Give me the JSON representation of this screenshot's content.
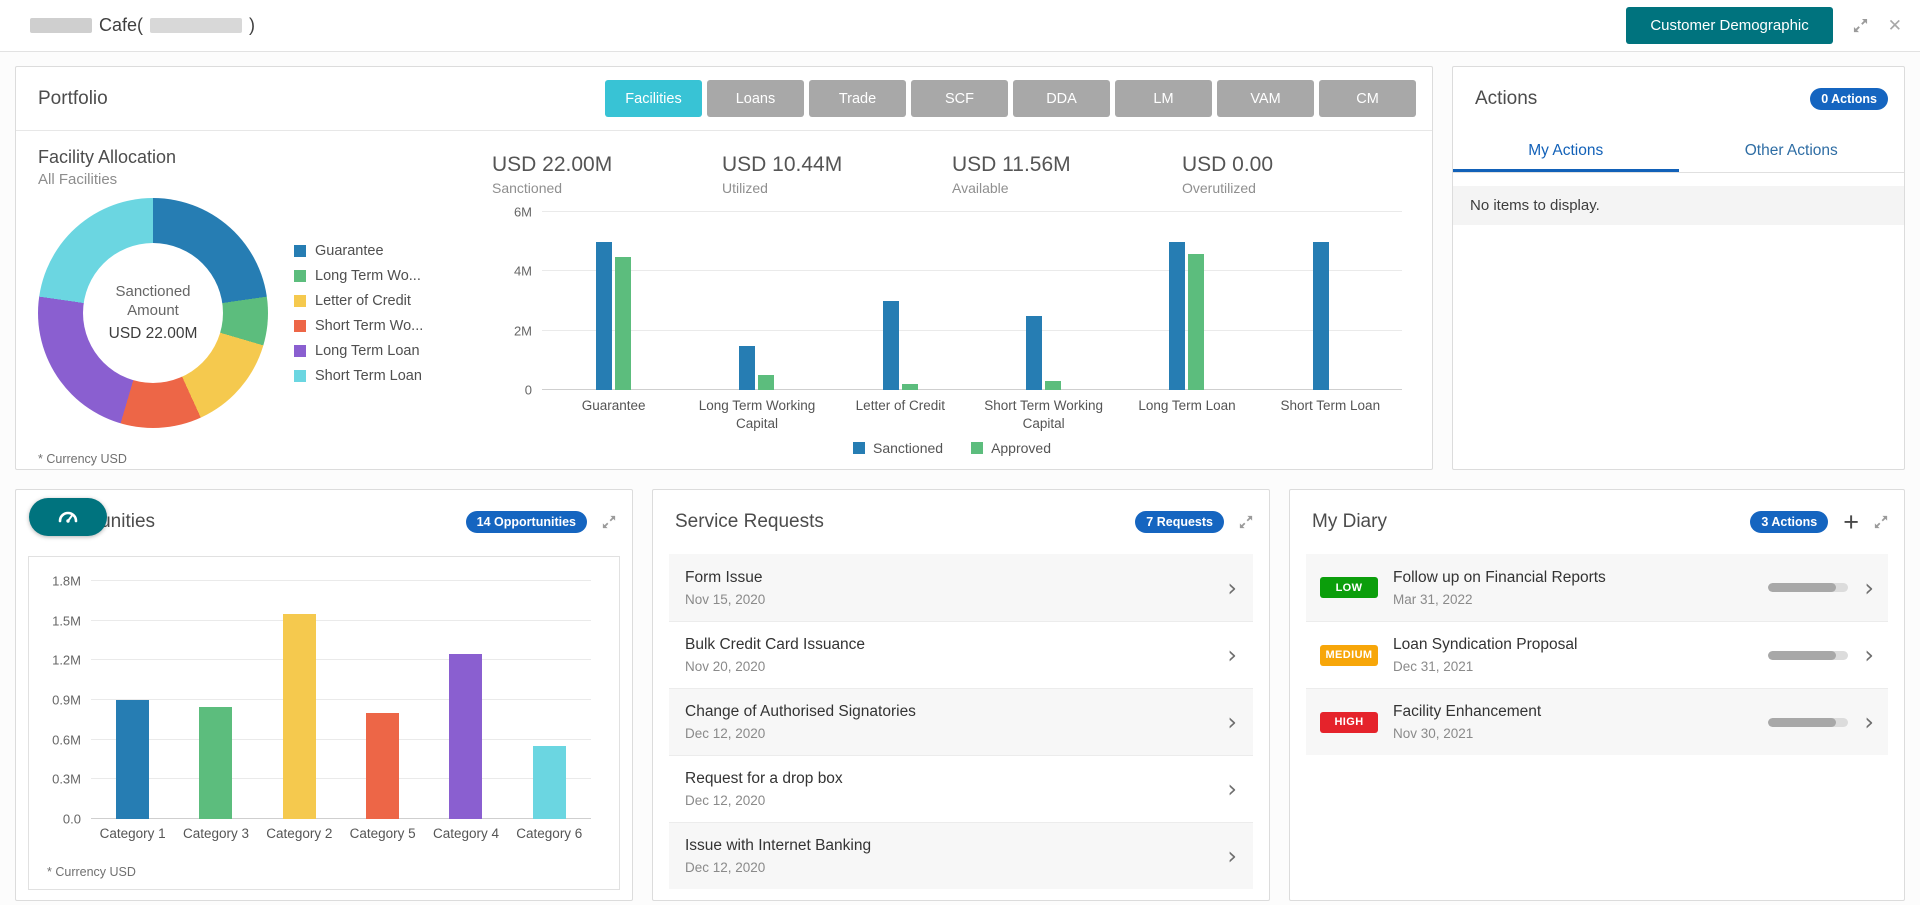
{
  "colors": {
    "accent_teal": "#00737e",
    "active_tab_cyan": "#38c3d5",
    "inactive_tab_gray": "#a8a8a8",
    "badge_blue": "#1565c0"
  },
  "icons": {
    "chevron_right": "›",
    "close": "✕",
    "plus": "+"
  },
  "header": {
    "title_cafe": "Cafe(",
    "title_paren": ")",
    "demographic_button": "Customer Demographic"
  },
  "portfolio": {
    "title": "Portfolio",
    "tabs": [
      {
        "label": "Facilities",
        "active": true
      },
      {
        "label": "Loans",
        "active": false
      },
      {
        "label": "Trade",
        "active": false
      },
      {
        "label": "SCF",
        "active": false
      },
      {
        "label": "DDA",
        "active": false
      },
      {
        "label": "LM",
        "active": false
      },
      {
        "label": "VAM",
        "active": false
      },
      {
        "label": "CM",
        "active": false
      }
    ],
    "facility_allocation": {
      "title": "Facility Allocation",
      "subtitle": "All Facilities",
      "center_label": "Sanctioned Amount",
      "center_value": "USD 22.00M",
      "footnote": "* Currency USD"
    },
    "summary": [
      {
        "value": "USD 22.00M",
        "label": "Sanctioned"
      },
      {
        "value": "USD 10.44M",
        "label": "Utilized"
      },
      {
        "value": "USD 11.56M",
        "label": "Available"
      },
      {
        "value": "USD 0.00",
        "label": "Overutilized"
      }
    ]
  },
  "actions": {
    "title": "Actions",
    "badge": "0 Actions",
    "tabs": [
      "My Actions",
      "Other Actions"
    ],
    "empty_message": "No items to display."
  },
  "opportunities": {
    "title": "Opportunities",
    "badge": "14 Opportunities",
    "footnote": "* Currency USD"
  },
  "service_requests": {
    "title": "Service Requests",
    "badge": "7 Requests",
    "items": [
      {
        "title": "Form Issue",
        "date": "Nov 15, 2020"
      },
      {
        "title": "Bulk Credit Card Issuance",
        "date": "Nov 20, 2020"
      },
      {
        "title": "Change of Authorised Signatories",
        "date": "Dec 12, 2020"
      },
      {
        "title": "Request for a drop box",
        "date": "Dec 12, 2020"
      },
      {
        "title": "Issue with Internet Banking",
        "date": "Dec 12, 2020"
      }
    ]
  },
  "my_diary": {
    "title": "My Diary",
    "badge": "3 Actions",
    "items": [
      {
        "priority": "LOW",
        "priority_color": "#0b9e0b",
        "title": "Follow up on Financial Reports",
        "date": "Mar 31, 2022",
        "progress_percent": 85
      },
      {
        "priority": "MEDIUM",
        "priority_color": "#f7a609",
        "title": "Loan Syndication Proposal",
        "date": "Dec 31, 2021",
        "progress_percent": 85
      },
      {
        "priority": "HIGH",
        "priority_color": "#e5232b",
        "title": "Facility Enhancement",
        "date": "Nov 30, 2021",
        "progress_percent": 85
      }
    ]
  },
  "chart_data": [
    {
      "id": "facility-allocation-donut",
      "type": "pie",
      "title": "Facility Allocation",
      "subtitle": "All Facilities",
      "center_label": "Sanctioned Amount",
      "center_value": "USD 22.00M",
      "unit": "USD millions",
      "categories": [
        "Guarantee",
        "Long Term Wo...",
        "Letter of Credit",
        "Short Term Wo...",
        "Long Term Loan",
        "Short Term Loan"
      ],
      "values": [
        5,
        1.5,
        3,
        2.5,
        5,
        5
      ],
      "colors": [
        "#267db3",
        "#5cbd7d",
        "#f5c94e",
        "#ed6647",
        "#8a5fd0",
        "#6bd6e1"
      ],
      "legend_position": "right"
    },
    {
      "id": "facility-bars",
      "type": "bar",
      "unit": "USD millions",
      "categories": [
        "Guarantee",
        "Long Term Working Capital",
        "Letter of Credit",
        "Short Term Working Capital",
        "Long Term Loan",
        "Short Term Loan"
      ],
      "series": [
        {
          "name": "Sanctioned",
          "color": "#267db3",
          "values": [
            5,
            1.5,
            3,
            2.5,
            5,
            5
          ]
        },
        {
          "name": "Approved",
          "color": "#5cbd7d",
          "values": [
            4.5,
            0.5,
            0.2,
            0.3,
            4.6,
            0
          ]
        }
      ],
      "ymax": 6,
      "ylim": [
        0,
        6
      ],
      "yticks": [
        {
          "v": 0,
          "label": "0"
        },
        {
          "v": 2,
          "label": "2M"
        },
        {
          "v": 4,
          "label": "4M"
        },
        {
          "v": 6,
          "label": "6M"
        }
      ],
      "legend_position": "bottom"
    },
    {
      "id": "opportunities-bars",
      "type": "bar",
      "unit": "USD millions",
      "categories": [
        "Category 1",
        "Category 3",
        "Category 2",
        "Category 5",
        "Category 4",
        "Category 6"
      ],
      "values": [
        0.9,
        0.85,
        1.55,
        0.8,
        1.25,
        0.55
      ],
      "colors": [
        "#267db3",
        "#5cbd7d",
        "#f5c94e",
        "#ed6647",
        "#8a5fd0",
        "#6bd6e1"
      ],
      "ymax": 1.8,
      "ylim": [
        0,
        1.8
      ],
      "yticks": [
        {
          "v": 0,
          "label": "0.0"
        },
        {
          "v": 0.3,
          "label": "0.3M"
        },
        {
          "v": 0.6,
          "label": "0.6M"
        },
        {
          "v": 0.9,
          "label": "0.9M"
        },
        {
          "v": 1.2,
          "label": "1.2M"
        },
        {
          "v": 1.5,
          "label": "1.5M"
        },
        {
          "v": 1.8,
          "label": "1.8M"
        }
      ]
    }
  ]
}
